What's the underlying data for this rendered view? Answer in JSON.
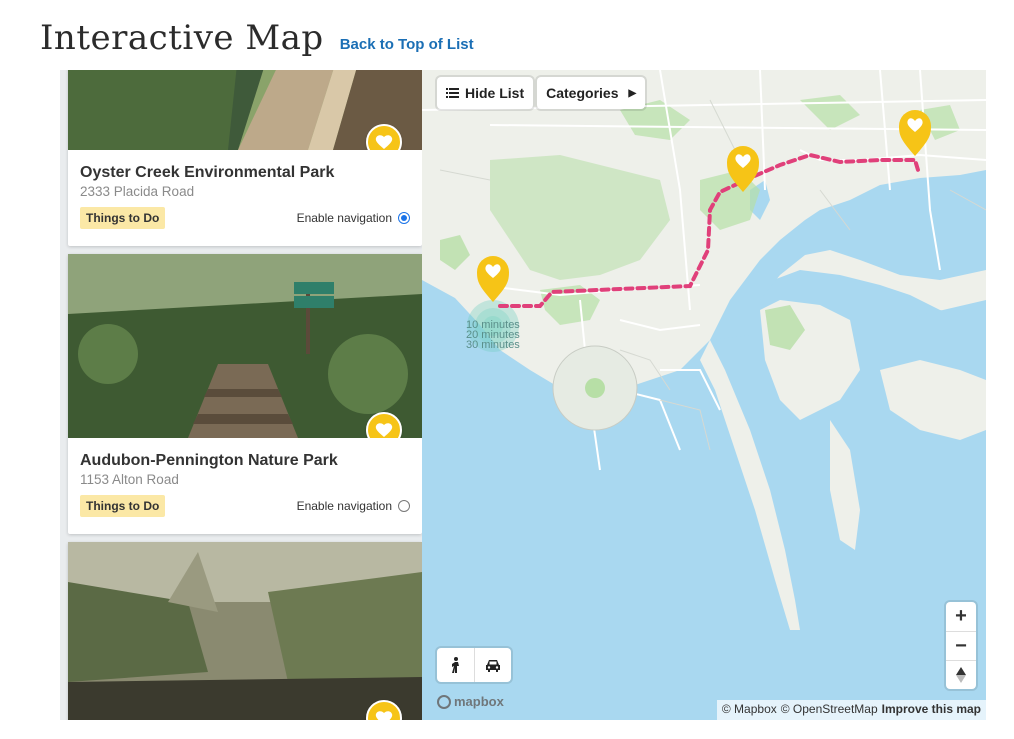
{
  "header": {
    "title": "Interactive Map",
    "back_link": "Back to Top of List"
  },
  "map_controls": {
    "hide_list_label": "Hide List",
    "categories_label": "Categories",
    "zoom_in": "+",
    "zoom_out": "−",
    "reset_north": "▲"
  },
  "listings": [
    {
      "name": "Oyster Creek Environmental Park",
      "address": "2333 Placida Road",
      "category": "Things to Do",
      "navigation_label": "Enable navigation",
      "navigation_enabled": true
    },
    {
      "name": "Audubon-Pennington Nature Park",
      "address": "1153 Alton Road",
      "category": "Things to Do",
      "navigation_label": "Enable navigation",
      "navigation_enabled": false
    },
    {
      "name": "",
      "address": "",
      "category": "",
      "navigation_label": "",
      "navigation_enabled": false
    }
  ],
  "isochrone_labels": [
    "10 minutes",
    "20 minutes",
    "30 minutes"
  ],
  "travel_modes": [
    "walking-icon",
    "driving-icon"
  ],
  "attribution": {
    "mapbox": "© Mapbox",
    "osm": "© OpenStreetMap",
    "improve": "Improve this map"
  },
  "mapbox_logo_text": "mapbox",
  "colors": {
    "water": "#a9d8f0",
    "land": "#eef0ea",
    "park": "#b7dfa6",
    "route": "#e0407a",
    "marker": "#f6c417",
    "link": "#1b6fb5",
    "tag": "#fbe8a6"
  }
}
